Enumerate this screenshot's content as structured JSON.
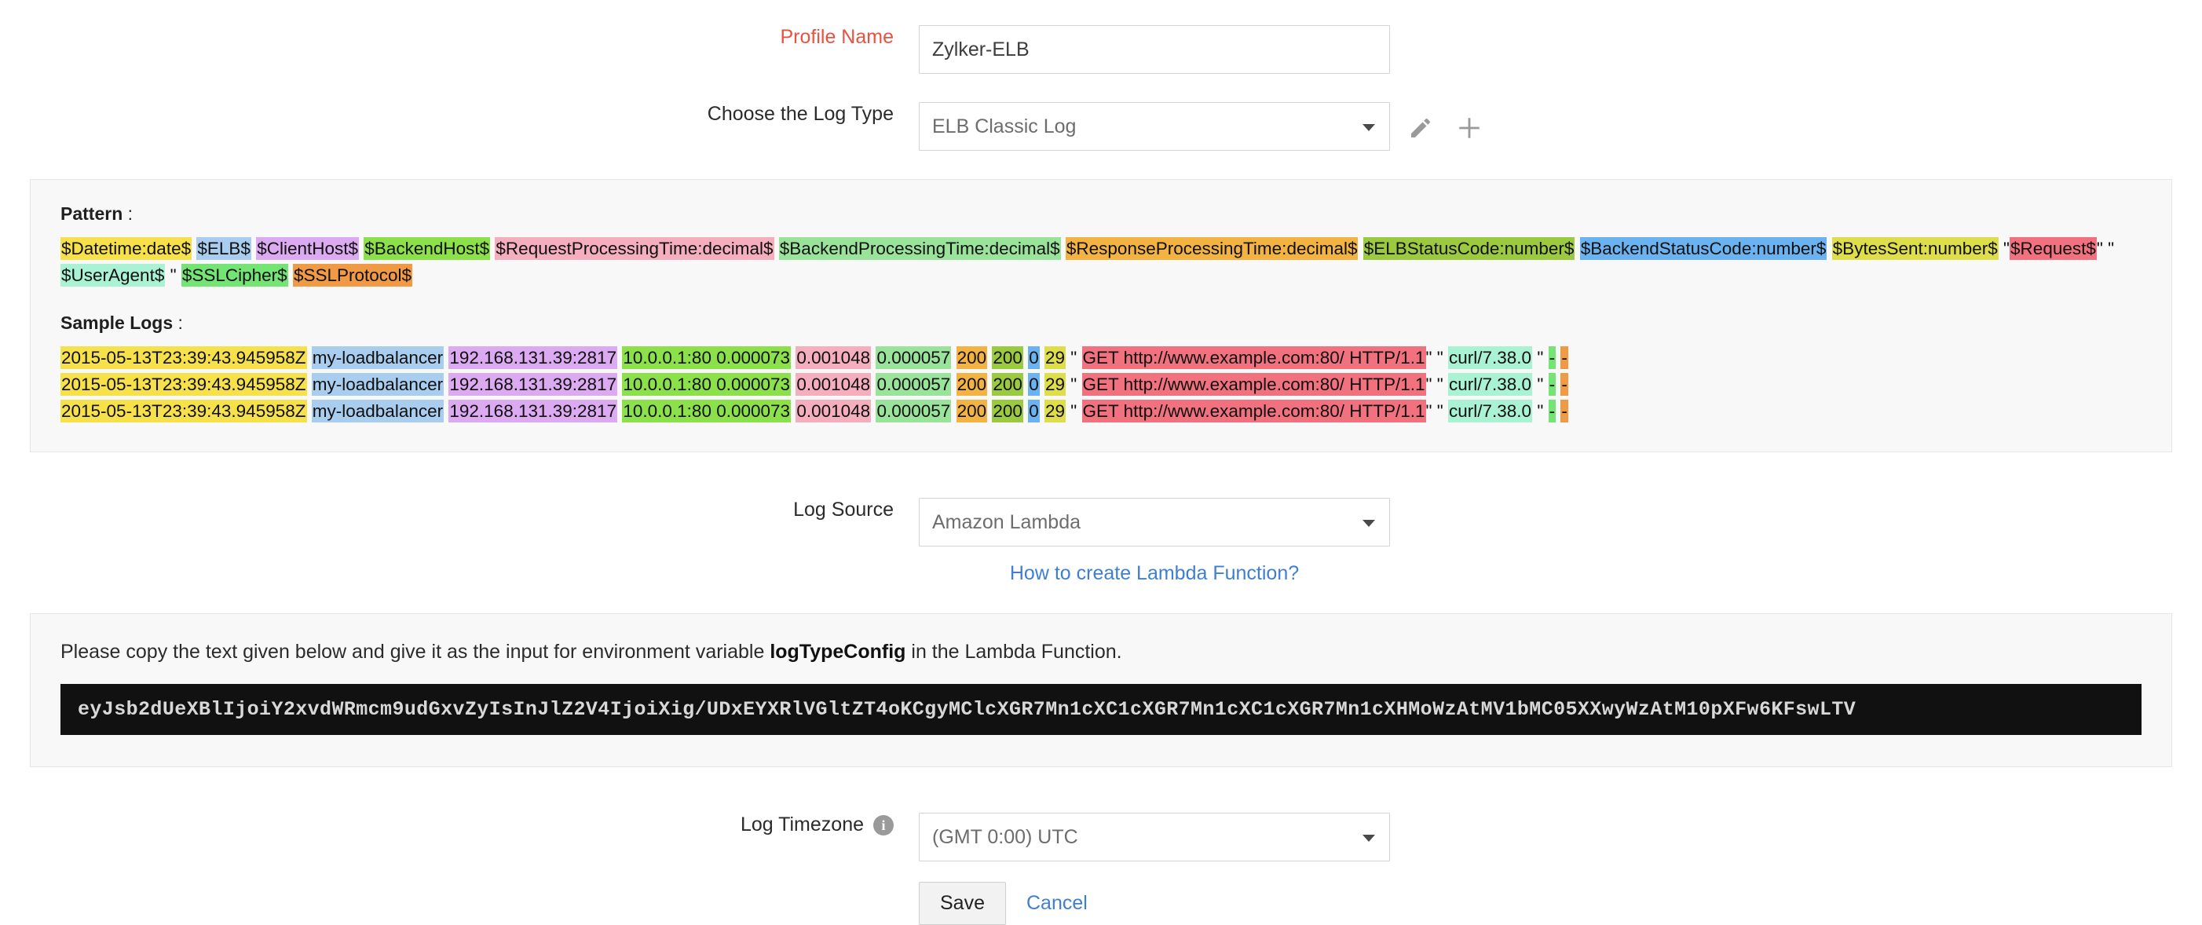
{
  "form": {
    "profile_name": {
      "label": "Profile Name",
      "value": "Zylker-ELB"
    },
    "log_type": {
      "label": "Choose the Log Type",
      "value": "ELB Classic Log",
      "edit_icon": "pencil-icon",
      "add_icon": "plus-icon"
    },
    "log_source": {
      "label": "Log Source",
      "value": "Amazon Lambda",
      "help_link": "How to create Lambda Function?"
    },
    "log_timezone": {
      "label": "Log Timezone",
      "value": "(GMT 0:00) UTC",
      "info_icon": "info-icon",
      "info_glyph": "i"
    },
    "actions": {
      "save_label": "Save",
      "cancel_label": "Cancel"
    }
  },
  "pattern_panel": {
    "pattern_heading": "Pattern",
    "pattern_heading_suffix": " :",
    "sample_heading": "Sample Logs",
    "sample_heading_suffix": " :",
    "pattern_tokens": [
      {
        "text": "$Datetime:date$",
        "bg": "#f7e14a"
      },
      {
        "text": " ",
        "bg": "transparent"
      },
      {
        "text": "$ELB$",
        "bg": "#a8cdee"
      },
      {
        "text": " ",
        "bg": "transparent"
      },
      {
        "text": "$ClientHost$",
        "bg": "#dcaaf0"
      },
      {
        "text": " ",
        "bg": "transparent"
      },
      {
        "text": "$BackendHost$",
        "bg": "#8ce04a"
      },
      {
        "text": " ",
        "bg": "transparent"
      },
      {
        "text": "$RequestProcessingTime:decimal$",
        "bg": "#f4aebd"
      },
      {
        "text": " ",
        "bg": "transparent"
      },
      {
        "text": "$BackendProcessingTime:decimal$",
        "bg": "#9ae39a"
      },
      {
        "text": " ",
        "bg": "transparent"
      },
      {
        "text": "$ResponseProcessingTime:decimal$",
        "bg": "#f3b342"
      },
      {
        "text": " ",
        "bg": "transparent"
      },
      {
        "text": "$ELBStatusCode:number$",
        "bg": "#9bc93f"
      },
      {
        "text": " ",
        "bg": "transparent"
      },
      {
        "text": "$BackendStatusCode:number$",
        "bg": "#6ab3f0"
      },
      {
        "text": " ",
        "bg": "transparent"
      },
      {
        "text": "$BytesSent:number$",
        "bg": "#ddde4a"
      },
      {
        "text": " \"",
        "bg": "transparent"
      }
    ],
    "pattern_tokens_line2": [
      {
        "text": "$Request$",
        "bg": "#f1717e"
      },
      {
        "text": "\" \"",
        "bg": "transparent"
      },
      {
        "text": "$UserAgent$",
        "bg": "#a9f2d4"
      },
      {
        "text": " \" ",
        "bg": "transparent"
      },
      {
        "text": "$SSLCipher$",
        "bg": "#74e474"
      },
      {
        "text": " ",
        "bg": "transparent"
      },
      {
        "text": "$SSLProtocol$",
        "bg": "#f09a45"
      }
    ],
    "sample_log_tokens": [
      {
        "text": "2015-05-13T23:39:43.945958Z",
        "bg": "#f7e14a"
      },
      {
        "text": " ",
        "bg": "transparent"
      },
      {
        "text": "my-loadbalancer",
        "bg": "#a8cdee"
      },
      {
        "text": " ",
        "bg": "transparent"
      },
      {
        "text": "192.168.131.39:2817",
        "bg": "#dcaaf0"
      },
      {
        "text": " ",
        "bg": "transparent"
      },
      {
        "text": "10.0.0.1:80 0.000073",
        "bg": "#8ce04a"
      },
      {
        "text": " ",
        "bg": "transparent"
      },
      {
        "text": "0.001048",
        "bg": "#f4aebd"
      },
      {
        "text": " ",
        "bg": "transparent"
      },
      {
        "text": "0.000057",
        "bg": "#9ae39a"
      },
      {
        "text": " ",
        "bg": "transparent"
      },
      {
        "text": "200",
        "bg": "#f3b342"
      },
      {
        "text": " ",
        "bg": "transparent"
      },
      {
        "text": "200",
        "bg": "#9bc93f"
      },
      {
        "text": " ",
        "bg": "transparent"
      },
      {
        "text": "0",
        "bg": "#6ab3f0"
      },
      {
        "text": " ",
        "bg": "transparent"
      },
      {
        "text": "29",
        "bg": "#ddde4a"
      },
      {
        "text": " \" ",
        "bg": "transparent"
      },
      {
        "text": "GET http://www.example.com:80/ HTTP/1.1",
        "bg": "#f1717e"
      },
      {
        "text": "\" \" ",
        "bg": "transparent"
      },
      {
        "text": "curl/7.38.0",
        "bg": "#a9f2d4"
      },
      {
        "text": " \" ",
        "bg": "transparent"
      },
      {
        "text": "-",
        "bg": "#74e474"
      },
      {
        "text": " ",
        "bg": "transparent"
      },
      {
        "text": "-",
        "bg": "#f09a45"
      }
    ],
    "sample_log_rows": 3
  },
  "lambda_panel": {
    "instruction_pre": "Please copy the text given below and give it as the input for environment variable ",
    "instruction_bold": "logTypeConfig",
    "instruction_post": " in the Lambda Function.",
    "config_token": "eyJsb2dUeXBlIjoiY2xvdWRmcm9udGxvZyIsInJlZ2V4IjoiXig/UDxEYXRlVGltZT4oKCgyMClcXGR7Mn1cXC1cXGR7Mn1cXC1cXGR7Mn1cXHMoWzAtMV1bMC05XXwyWzAtM10pXFw6KFswLTV"
  },
  "colors": {
    "required_label": "#e8523f",
    "link": "#3f7fd0",
    "panel_bg": "#f8f8f8",
    "panel_border": "#e6e6e6",
    "code_bg": "#111111",
    "code_text": "#d8d8d8"
  }
}
